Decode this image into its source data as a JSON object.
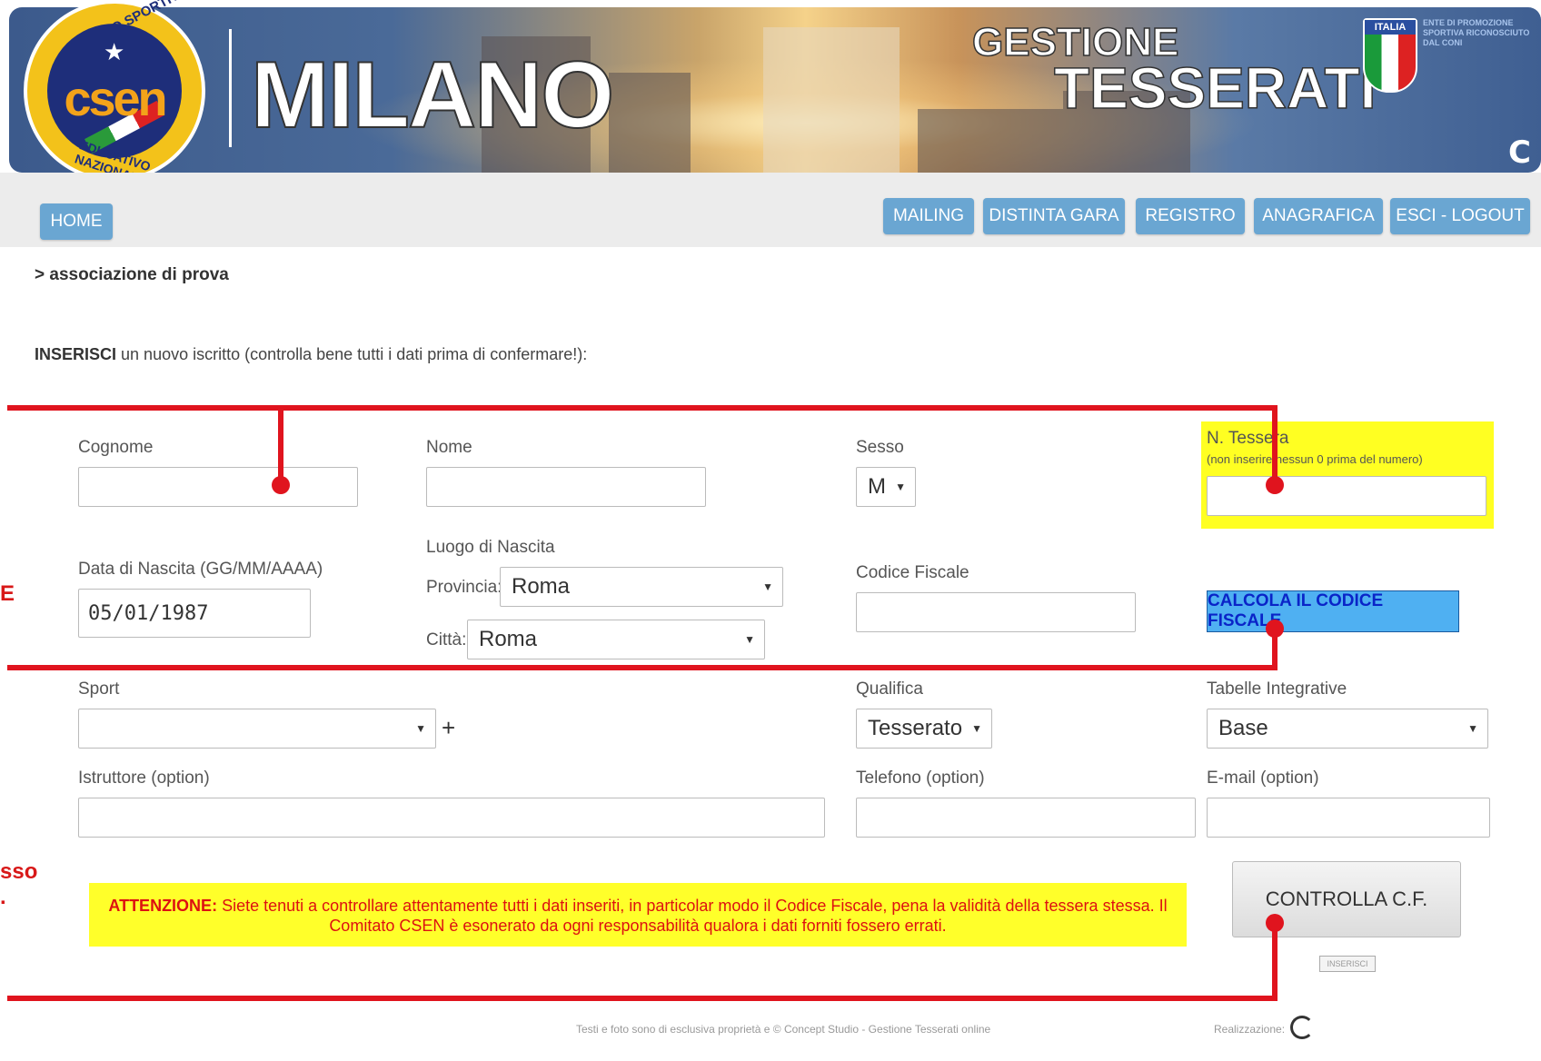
{
  "header": {
    "city": "MILANO",
    "title_line1": "GESTIONE",
    "title_line2": "TESSERATI",
    "logo_text": "csen",
    "logo_ring_top": "CENTRO SPORTIVO",
    "logo_ring_bottom": "EDUCATIVO NAZIONALE",
    "shield_label": "ITALIA",
    "coni_text": "ENTE DI PROMOZIONE SPORTIVA RICONOSCIUTO DAL CONI",
    "refresh_icon": "C"
  },
  "nav": {
    "home": "HOME",
    "items": [
      "MAILING",
      "DISTINTA GARA",
      "REGISTRO",
      "ANAGRAFICA",
      "ESCI - LOGOUT"
    ]
  },
  "breadcrumb": "> associazione di prova",
  "intro": {
    "bold": "INSERISCI",
    "rest": " un nuovo iscritto (controlla bene tutti i dati prima di confermare!):"
  },
  "form": {
    "cognome_label": "Cognome",
    "nome_label": "Nome",
    "sesso_label": "Sesso",
    "sesso_value": "M",
    "tessera_label": "N. Tessera",
    "tessera_note": "(non inserire nessun 0 prima del numero)",
    "nascita_label": "Data di Nascita (GG/MM/AAAA)",
    "nascita_value": "05/01/1987",
    "luogo_label": "Luogo di Nascita",
    "provincia_label": "Provincia:",
    "provincia_value": "Roma",
    "citta_label": "Città:",
    "citta_value": "Roma",
    "cf_label": "Codice Fiscale",
    "cf_button": "CALCOLA IL CODICE FISCALE",
    "sport_label": "Sport",
    "sport_add": "+",
    "qualifica_label": "Qualifica",
    "qualifica_value": "Tesserato",
    "tabelle_label": "Tabelle Integrative",
    "tabelle_value": "Base",
    "istruttore_label": "Istruttore (option)",
    "telefono_label": "Telefono (option)",
    "email_label": "E-mail (option)"
  },
  "warning": {
    "bold": "ATTENZIONE:",
    "text": " Siete tenuti a controllare attentamente tutti i dati inseriti, in particolar modo il Codice Fiscale, pena la validità della tessera stessa. Il Comitato CSEN è esonerato da ogni responsabilità qualora i dati forniti fossero errati."
  },
  "controlla_button": "CONTROLLA C.F.",
  "inserisci_button": "INSERISCI",
  "footer": "Testi e foto sono di esclusiva proprietà e © Concept Studio - Gestione Tesserati online",
  "realizzazione": "Realizzazione:",
  "left_edge_text": {
    "a": "E",
    "b": "sso",
    "c": "."
  },
  "colors": {
    "nav": "#6aa6d2",
    "highlight": "#ffff22",
    "overlay_red": "#e0141e",
    "cf_button": "#4fb0f2"
  }
}
